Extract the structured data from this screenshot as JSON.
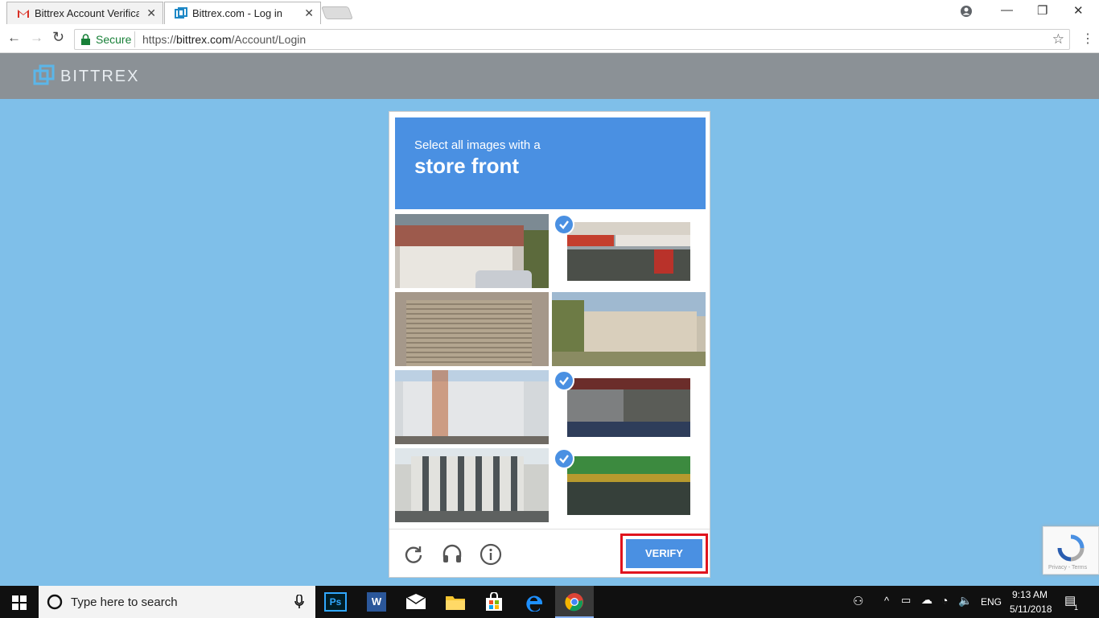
{
  "browser": {
    "tabs": [
      {
        "label": "Bittrex Account Verificatio"
      },
      {
        "label": "Bittrex.com - Log in"
      }
    ],
    "security_label": "Secure",
    "url_scheme": "https://",
    "url_host": "bittrex.com",
    "url_path": "/Account/Login"
  },
  "header": {
    "brand": "BITTREX"
  },
  "captcha": {
    "prompt_line1": "Select all images with a",
    "prompt_line2": "store front",
    "tiles": [
      {
        "desc": "house-garage",
        "selected": false
      },
      {
        "desc": "storefront-pawn",
        "selected": true
      },
      {
        "desc": "roll-up-door",
        "selected": false
      },
      {
        "desc": "house-palms",
        "selected": false
      },
      {
        "desc": "white-building",
        "selected": false
      },
      {
        "desc": "storefront-awning",
        "selected": true
      },
      {
        "desc": "office-building",
        "selected": false
      },
      {
        "desc": "storefront-artsom",
        "selected": true
      }
    ],
    "verify_label": "VERIFY",
    "reload_icon": "reload-icon",
    "audio_icon": "headphones-icon",
    "info_icon": "info-icon"
  },
  "recaptcha_badge": {
    "footer": "Privacy - Terms"
  },
  "taskbar": {
    "search_placeholder": "Type here to search",
    "language": "ENG",
    "time": "9:13 AM",
    "date": "5/11/2018",
    "notification_count": "1"
  },
  "colors": {
    "accent": "#4a90e2",
    "page_bg": "#7fbfe9",
    "header_bg": "#8b9196",
    "highlight": "#e0141e"
  }
}
